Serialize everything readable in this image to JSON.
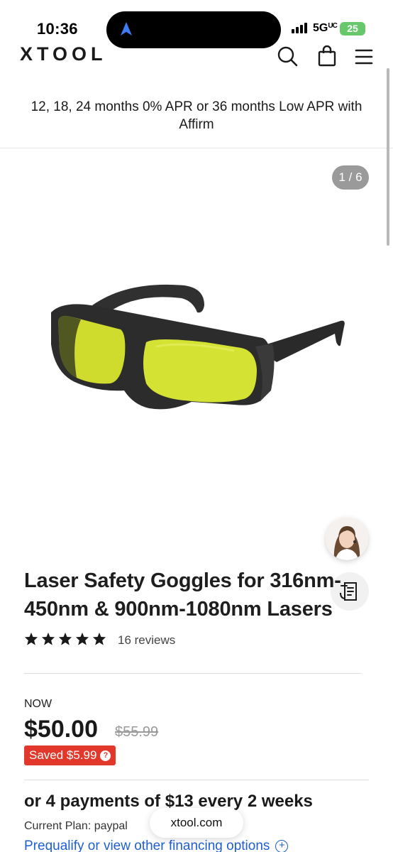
{
  "status_bar": {
    "time": "10:36",
    "network": "5G",
    "network_sub": "UC",
    "battery": "25"
  },
  "header": {
    "logo": "XTOOL",
    "icons": [
      "search-icon",
      "shopping-bag-icon",
      "menu-icon"
    ]
  },
  "promo": {
    "text": "12, 18, 24 months 0% APR or 36 months Low APR with Affirm"
  },
  "gallery": {
    "counter": "1 / 6"
  },
  "product": {
    "title": "Laser Safety Goggles for 316nm-450nm & 900nm-1080nm Lasers",
    "rating": 5,
    "reviews": "16 reviews",
    "now_label": "NOW",
    "price": "$50.00",
    "compare_price": "$55.99",
    "saved": "Saved $5.99"
  },
  "financing": {
    "installments": "or 4 payments of $13 every 2 weeks",
    "plan": "Current Plan: paypal",
    "link": "Prequalify or view other financing options"
  },
  "browser": {
    "url": "xtool.com"
  },
  "colors": {
    "sale_red": "#e2382b",
    "link_blue": "#1f5fd1",
    "lens_yellow": "#d4e233"
  }
}
